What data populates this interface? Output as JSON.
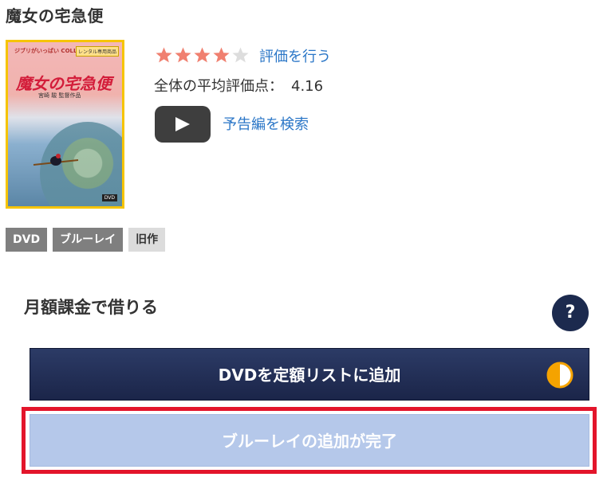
{
  "product": {
    "title": "魔女の宅急便"
  },
  "cover": {
    "series_text": "ジブリがいっぱい COLLECTION",
    "rental_badge": "レンタル専用商品",
    "title_text": "魔女の宅急便",
    "director_text": "宮崎 駿 監督作品",
    "format_logo": "DVD"
  },
  "rating": {
    "stars_filled": 4,
    "stars_total": 5,
    "rate_link": "評価を行う",
    "average_label": "全体の平均評価点：",
    "average_value": "4.16",
    "star_color": "#f08070",
    "star_empty_color": "#dddddd"
  },
  "trailer": {
    "icon": "play-icon",
    "link": "予告編を検索"
  },
  "tags": [
    "DVD",
    "ブルーレイ",
    "旧作"
  ],
  "subscription": {
    "title": "月額課金で借りる",
    "help_label": "?",
    "dvd_button": "DVDを定額リストに追加",
    "dvd_status_icon": "half-circle-icon",
    "bluray_button": "ブルーレイの追加が完了",
    "highlight_color": "#e3152b",
    "accent_color": "#1c2a4e"
  }
}
